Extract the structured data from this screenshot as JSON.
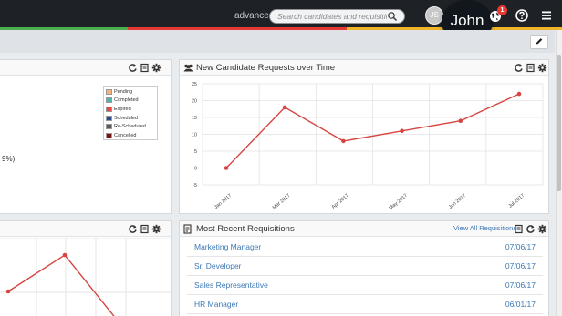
{
  "topbar": {
    "advanced_label": "advanced",
    "search_placeholder": "Search candidates and requisitions",
    "user_initials": "JS",
    "user_name": "John",
    "notification_count": "1",
    "stripe_colors": [
      "#4caf50",
      "#e53935",
      "#f0b429"
    ]
  },
  "panels": {
    "status": {
      "legend": [
        {
          "label": "Pending",
          "color": "#f6b27a"
        },
        {
          "label": "Completed",
          "color": "#4db6ac"
        },
        {
          "label": "Expired",
          "color": "#e84545"
        },
        {
          "label": "Scheduled",
          "color": "#2a4b8d"
        },
        {
          "label": "Re-Scheduled",
          "color": "#5a5a5a"
        },
        {
          "label": "Cancelled",
          "color": "#7a1212"
        }
      ],
      "percent_fragment": "9%)"
    },
    "requests": {
      "title": "New Candidate Requests over Time",
      "chart_data": {
        "type": "line",
        "categories": [
          "Jan 2017",
          "Mar 2017",
          "Apr 2017",
          "May 2017",
          "Jun 2017",
          "Jul 2017"
        ],
        "values": [
          0,
          18,
          8,
          11,
          14,
          22
        ],
        "yticks": [
          25,
          20,
          15,
          10,
          5,
          0,
          -5
        ],
        "ylim": [
          -5,
          25
        ],
        "title": "New Candidate Requests over Time",
        "color": "#d64541",
        "grid": true
      }
    },
    "trend": {
      "chart_data": {
        "type": "line",
        "values": [
          null,
          null,
          null
        ],
        "color": "#d64541"
      }
    },
    "requisitions": {
      "title": "Most Recent Requisitions",
      "view_all": "View All Requisitions",
      "rows": [
        {
          "title": "Marketing Manager",
          "date": "07/06/17"
        },
        {
          "title": "Sr. Developer",
          "date": "07/06/17"
        },
        {
          "title": "Sales Representative",
          "date": "07/06/17"
        },
        {
          "title": "HR Manager",
          "date": "06/01/17"
        }
      ]
    }
  }
}
